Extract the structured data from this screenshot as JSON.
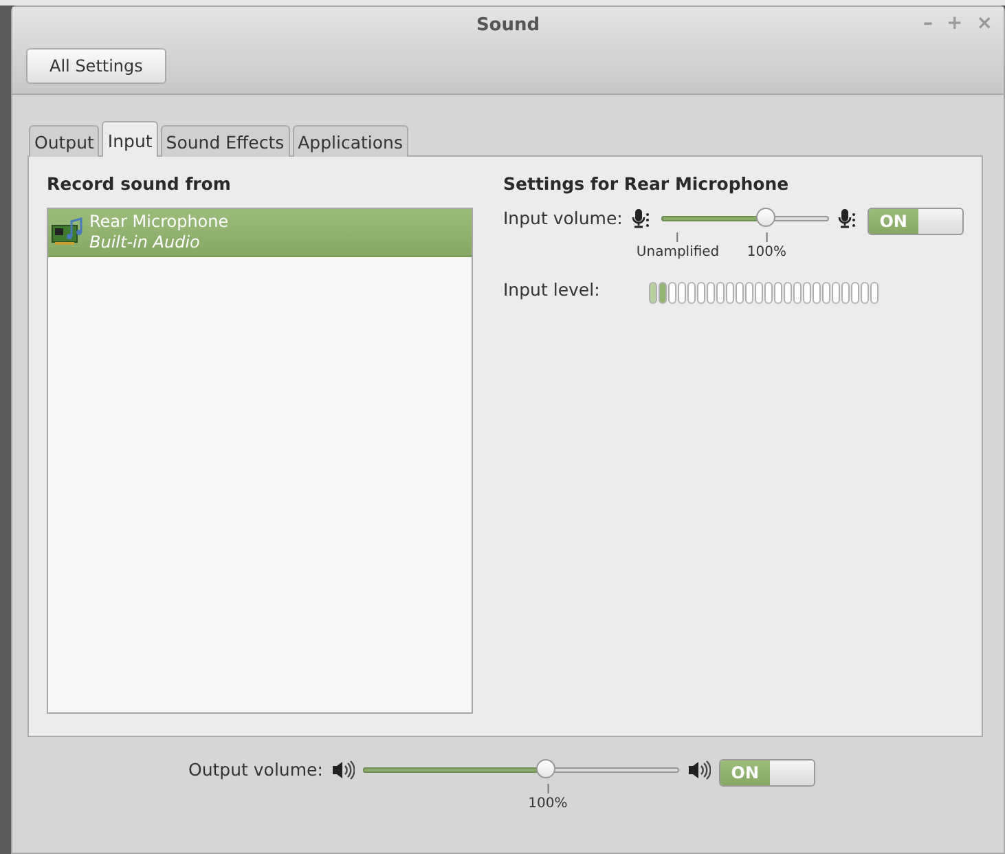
{
  "window": {
    "title": "Sound",
    "controls": [
      "–",
      "+",
      "×"
    ]
  },
  "header": {
    "button": "All Settings"
  },
  "tabs": [
    {
      "label": "Output",
      "selected": false
    },
    {
      "label": "Input",
      "selected": true
    },
    {
      "label": "Sound Effects",
      "selected": false
    },
    {
      "label": "Applications",
      "selected": false
    }
  ],
  "devices": {
    "heading": "Record sound from",
    "items": [
      {
        "name": "Rear Microphone",
        "subtitle": "Built-in Audio",
        "selected": true
      }
    ]
  },
  "settings": {
    "heading": "Settings for Rear Microphone",
    "input_volume": {
      "label": "Input volume:",
      "level": 0.63,
      "marks": [
        {
          "label": "Unamplified",
          "kind": "unamplified"
        },
        {
          "label": "100%",
          "kind": "normal"
        }
      ],
      "switch": {
        "label": "ON",
        "on": true
      }
    },
    "input_level": {
      "label": "Input level:",
      "level": 0.083
    }
  },
  "output": {
    "label": "Output volume:",
    "level": 0.585,
    "marks": [
      {
        "label": "100%",
        "kind": "normal"
      }
    ],
    "switch": {
      "label": "ON",
      "on": true
    }
  }
}
